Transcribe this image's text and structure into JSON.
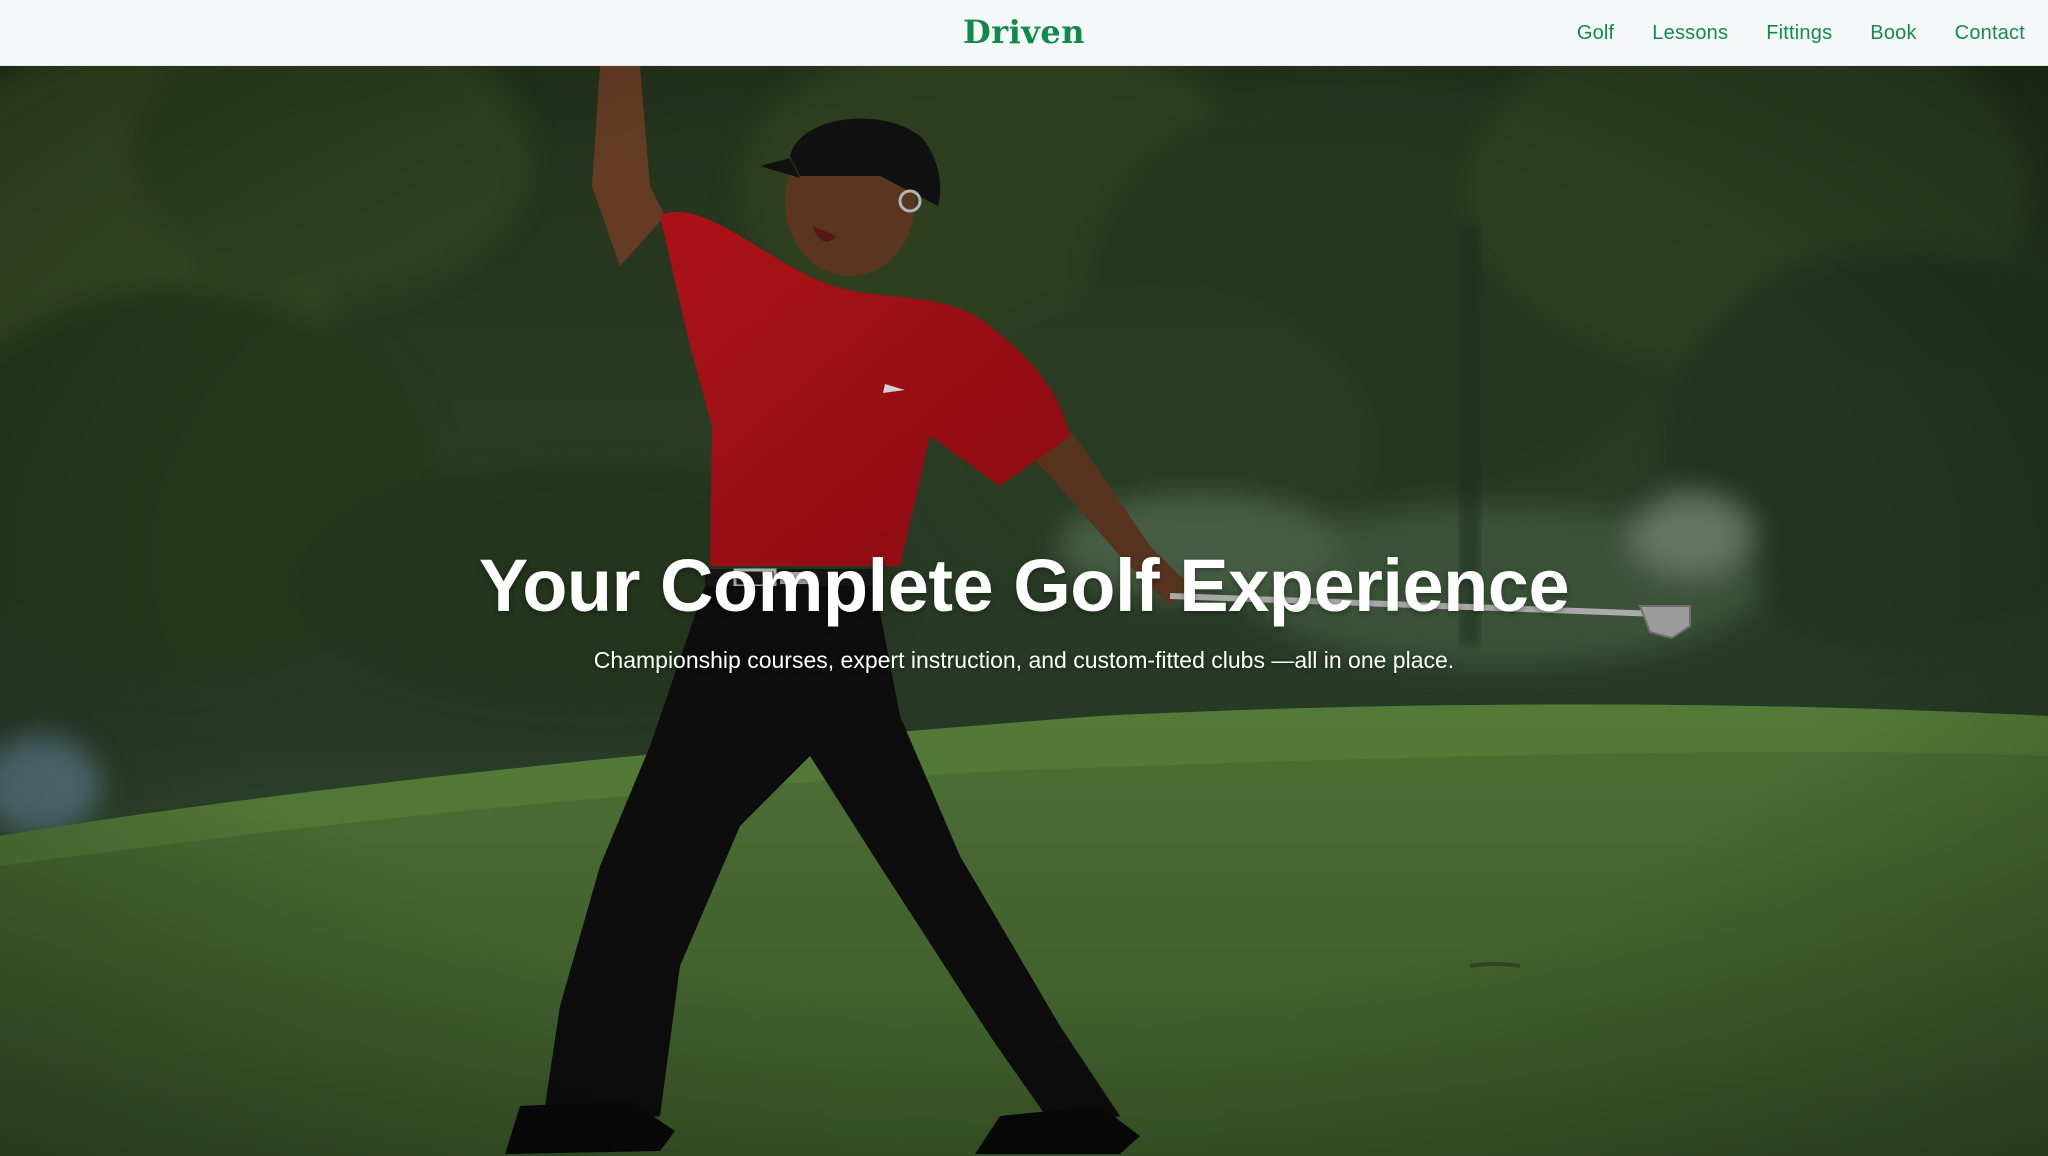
{
  "header": {
    "brand": "Driven",
    "nav": [
      {
        "label": "Golf"
      },
      {
        "label": "Lessons"
      },
      {
        "label": "Fittings"
      },
      {
        "label": "Book"
      },
      {
        "label": "Contact"
      }
    ]
  },
  "hero": {
    "title": "Your Complete Golf Experience",
    "subtitle": "Championship courses, expert instruction, and custom-fitted clubs —all in one place."
  },
  "colors": {
    "accent": "#128c4c",
    "header_bg": "#f6f7f8",
    "shirt_red": "#c8141c",
    "green": "#5e8a3c"
  }
}
